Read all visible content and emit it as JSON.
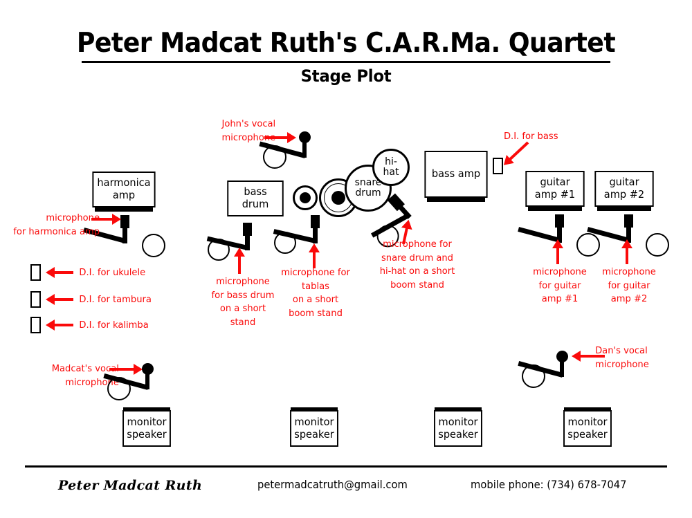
{
  "header": {
    "title": "Peter Madcat Ruth's C.A.R.Ma. Quartet",
    "subtitle": "Stage Plot"
  },
  "footer": {
    "name": "Peter Madcat Ruth",
    "email": "petermadcatruth@gmail.com",
    "phone": "mobile phone: (734) 678-7047"
  },
  "colors": {
    "annotation_red": "#FA0A0A",
    "ink_black": "#000000",
    "background": "#FFFFFF"
  },
  "equipment": {
    "harmonica_amp": "harmonica\namp",
    "bass_drum": "bass\ndrum",
    "snare_drum": "snare\ndrum",
    "hi_hat": "hi-\nhat",
    "bass_amp": "bass amp",
    "guitar_amp_1": "guitar\namp #1",
    "guitar_amp_2": "guitar\namp #2",
    "monitor_1": "monitor\nspeaker",
    "monitor_2": "monitor\nspeaker",
    "monitor_3": "monitor\nspeaker",
    "monitor_4": "monitor\nspeaker"
  },
  "annotations": {
    "mic_harmonica_amp": "microphone\nfor harmonica amp",
    "di_ukulele": "D.I. for ukulele",
    "di_tambura": "D.I. for tambura",
    "di_kalimba": "D.I. for kalimba",
    "john_vocal_mic": "John's vocal\nmicrophone",
    "mic_bass_drum": "microphone\nfor bass drum\non a short\nstand",
    "mic_tablas": "microphone for\ntablas\non a short\nboom stand",
    "mic_snare_hihat": "microphone for\nsnare drum and\nhi-hat on a short\nboom stand",
    "di_bass": "D.I. for bass",
    "mic_guitar_amp_1": "microphone\nfor guitar\namp #1",
    "mic_guitar_amp_2": "microphone\nfor guitar\namp #2",
    "madcat_vocal_mic": "Madcat's vocal\nmicrophone",
    "dan_vocal_mic": "Dan's vocal\nmicrophone"
  }
}
